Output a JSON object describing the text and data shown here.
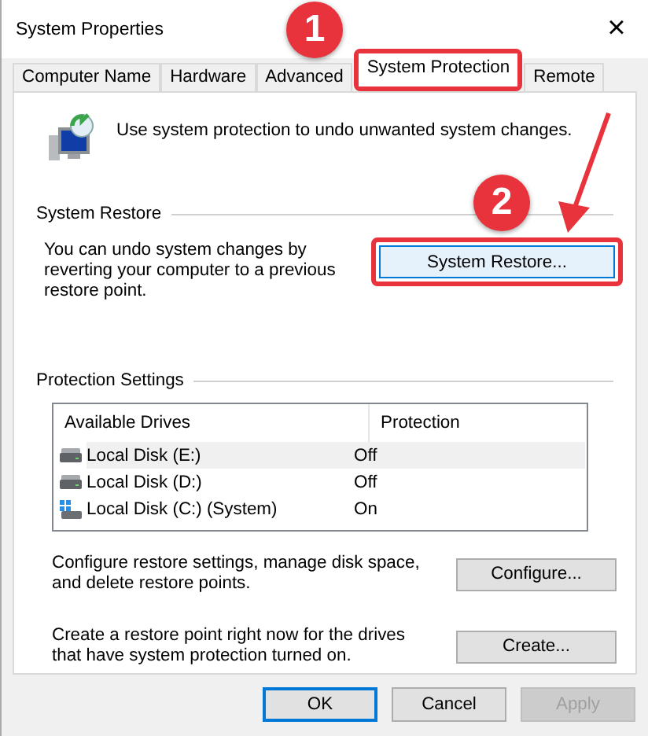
{
  "window": {
    "title": "System Properties",
    "close": "×"
  },
  "tabs": [
    {
      "label": "Computer Name",
      "selected": false,
      "highlighted": false
    },
    {
      "label": "Hardware",
      "selected": false,
      "highlighted": false
    },
    {
      "label": "Advanced",
      "selected": false,
      "highlighted": false
    },
    {
      "label": "System Protection",
      "selected": true,
      "highlighted": true
    },
    {
      "label": "Remote",
      "selected": false,
      "highlighted": false
    }
  ],
  "intro": "Use system protection to undo unwanted system changes.",
  "system_restore": {
    "title": "System Restore",
    "description": "You can undo system changes by reverting your computer to a previous restore point.",
    "button": {
      "label": "System Restore...",
      "highlighted": true
    }
  },
  "protection_settings": {
    "title": "Protection Settings",
    "columns": [
      "Available Drives",
      "Protection"
    ],
    "rows": [
      {
        "drive": "Local Disk (E:)",
        "protection": "Off",
        "kind": "disk",
        "selected": true
      },
      {
        "drive": "Local Disk (D:)",
        "protection": "Off",
        "kind": "disk",
        "selected": false
      },
      {
        "drive": "Local Disk (C:) (System)",
        "protection": "On",
        "kind": "system",
        "selected": false
      }
    ]
  },
  "actions": [
    {
      "text": "Configure restore settings, manage disk space, and delete restore points.",
      "button": "Configure..."
    },
    {
      "text": "Create a restore point right now for the drives that have system protection turned on.",
      "button": "Create..."
    }
  ],
  "buttons": [
    {
      "label": "OK",
      "kind": "default",
      "disabled": false
    },
    {
      "label": "Cancel",
      "kind": "normal",
      "disabled": false
    },
    {
      "label": "Apply",
      "kind": "normal",
      "disabled": true
    }
  ],
  "annotations": [
    {
      "label": "1"
    },
    {
      "label": "2"
    }
  ]
}
